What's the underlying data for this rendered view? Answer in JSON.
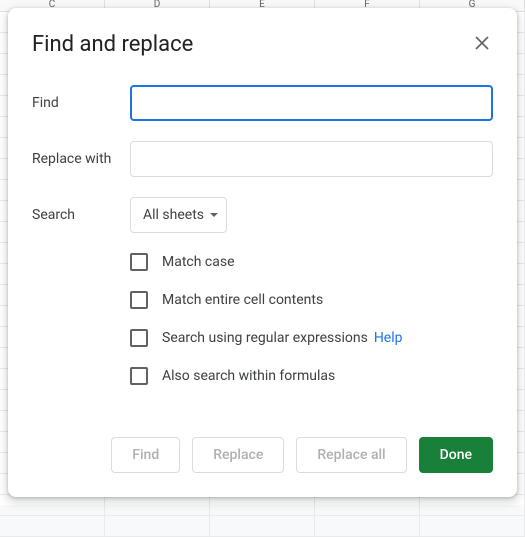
{
  "bg": {
    "columns": [
      "C",
      "D",
      "E",
      "F",
      "G"
    ]
  },
  "dialog": {
    "title": "Find and replace",
    "labels": {
      "find": "Find",
      "replace_with": "Replace with",
      "search": "Search"
    },
    "fields": {
      "find_value": "",
      "replace_value": ""
    },
    "search_scope": {
      "selected": "All sheets"
    },
    "options": {
      "match_case": "Match case",
      "match_entire": "Match entire cell contents",
      "regex": "Search using regular expressions",
      "help": "Help",
      "formulas": "Also search within formulas"
    },
    "buttons": {
      "find": "Find",
      "replace": "Replace",
      "replace_all": "Replace all",
      "done": "Done"
    }
  }
}
